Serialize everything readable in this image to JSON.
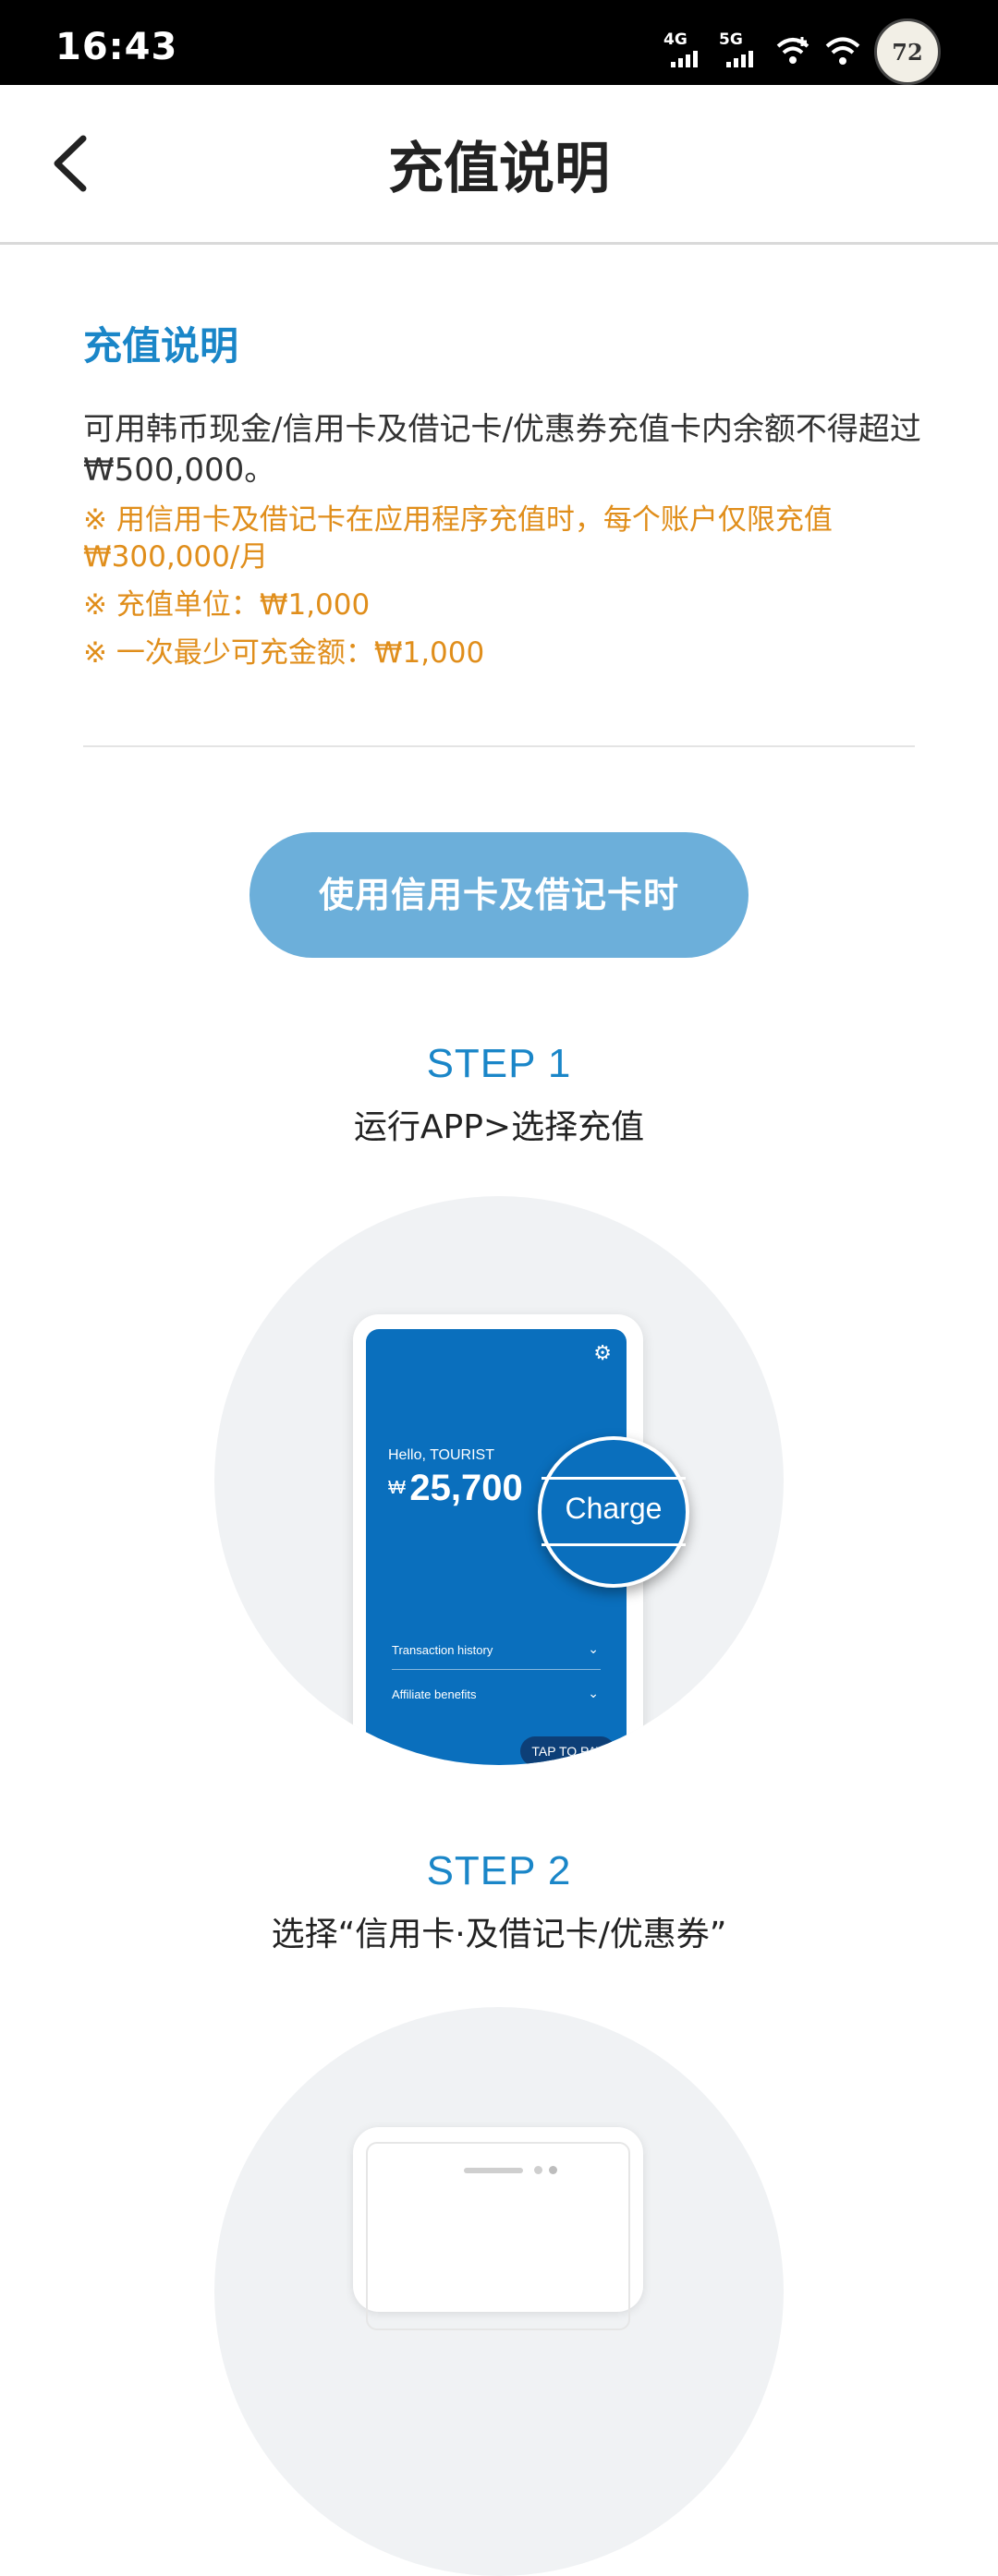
{
  "status_bar": {
    "time": "16:43",
    "network_1": "4G",
    "network_2": "5G",
    "avatar_text": "72"
  },
  "header": {
    "title": "充值说明"
  },
  "section": {
    "title": "充值说明",
    "description": "可用韩币现金/信用卡及借记卡/优惠券充值卡内余额不得超过₩500,000。",
    "notes": [
      "※ 用信用卡及借记卡在应用程序充值时，每个账户仅限充值₩300,000/月",
      "※ 充值单位：₩1,000",
      "※ 一次最少可充金额：₩1,000"
    ]
  },
  "card_button": {
    "label": "使用信用卡及借记卡时"
  },
  "steps": [
    {
      "number": "STEP 1",
      "text": "运行APP>选择充值"
    },
    {
      "number": "STEP 2",
      "text": "选择“信用卡·及借记卡/优惠券”"
    }
  ],
  "illustration_1": {
    "greeting": "Hello, TOURIST",
    "currency": "₩",
    "balance": "25,700",
    "charge_label": "Charge",
    "menu": [
      "Transaction history",
      "Affiliate benefits"
    ],
    "tap_to_pay": "TAP TO PAY"
  },
  "colors": {
    "accent": "#1a86c8",
    "note": "#e08e1b",
    "pill": "#6cafda",
    "app_blue": "#0a6fbd"
  }
}
